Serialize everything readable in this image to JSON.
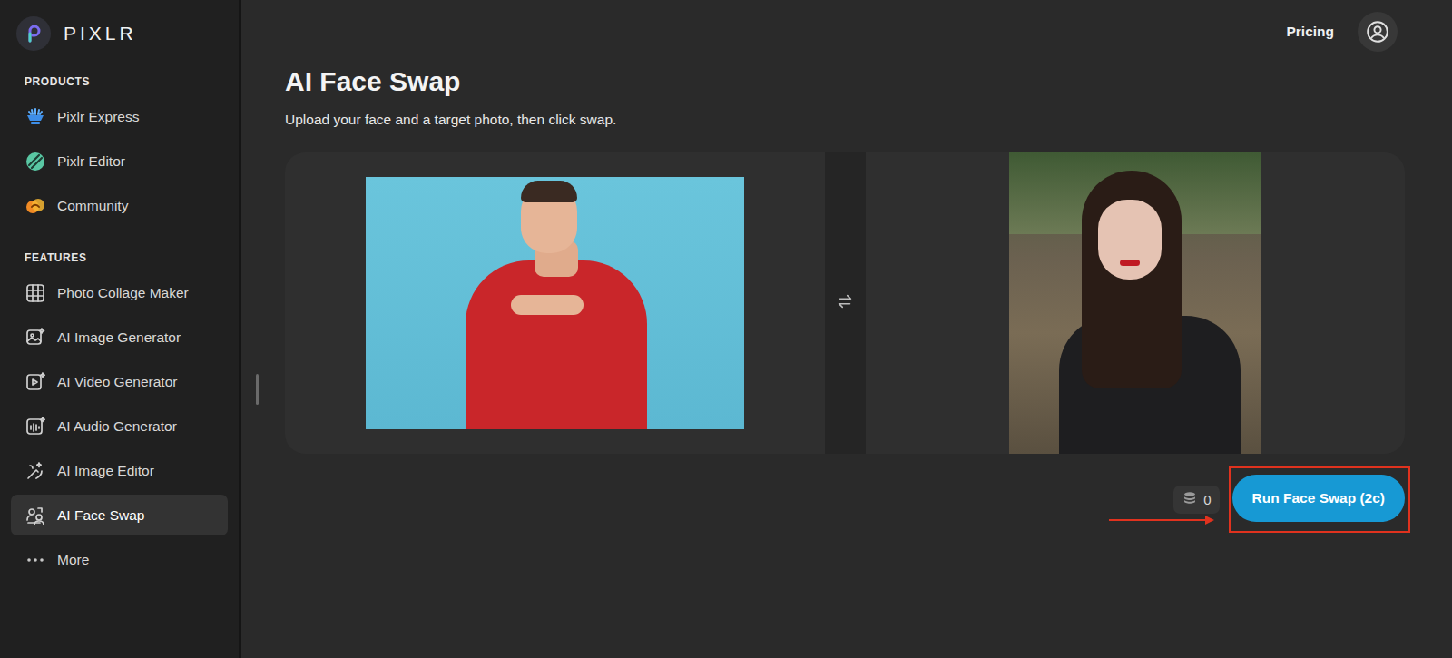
{
  "app": {
    "logo": "PIXLR"
  },
  "topbar": {
    "pricing": "Pricing"
  },
  "sidebar": {
    "sections": [
      {
        "title": "PRODUCTS",
        "items": [
          {
            "label": "Pixlr Express",
            "selected": false
          },
          {
            "label": "Pixlr Editor",
            "selected": false
          },
          {
            "label": "Community",
            "selected": false
          }
        ]
      },
      {
        "title": "FEATURES",
        "items": [
          {
            "label": "Photo Collage Maker",
            "selected": false
          },
          {
            "label": "AI Image Generator",
            "selected": false
          },
          {
            "label": "AI Video Generator",
            "selected": false
          },
          {
            "label": "AI Audio Generator",
            "selected": false
          },
          {
            "label": "AI Image Editor",
            "selected": false
          },
          {
            "label": "AI Face Swap",
            "selected": true
          },
          {
            "label": "More",
            "selected": false
          }
        ]
      }
    ]
  },
  "page": {
    "title": "AI Face Swap",
    "subtitle": "Upload your face and a target photo, then click swap."
  },
  "credits": {
    "count": "0"
  },
  "run_button": {
    "label": "Run Face Swap (2c)"
  }
}
